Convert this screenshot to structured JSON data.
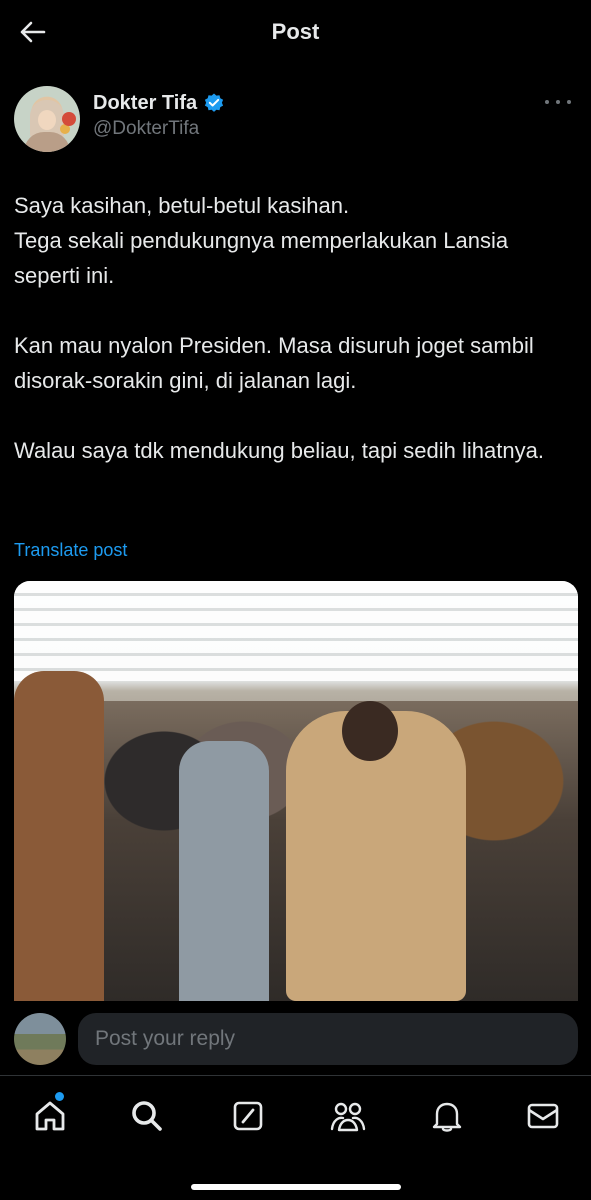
{
  "header": {
    "title": "Post"
  },
  "author": {
    "display_name": "Dokter Tifa",
    "handle": "@DokterTifa",
    "verified": true,
    "verified_color": "#1d9bf0"
  },
  "post": {
    "paragraphs": [
      "Saya kasihan, betul-betul kasihan.\nTega sekali pendukungnya memperlakukan Lansia seperti ini.",
      "Kan mau nyalon Presiden. Masa disuruh joget sambil disorak-sorakin gini, di jalanan lagi.",
      "Walau saya tdk mendukung beliau, tapi sedih lihatnya."
    ],
    "translate_label": "Translate post"
  },
  "reply": {
    "placeholder": "Post your reply"
  },
  "nav": {
    "items": [
      {
        "icon": "home-icon",
        "has_notification_dot": true
      },
      {
        "icon": "search-icon"
      },
      {
        "icon": "grok-icon"
      },
      {
        "icon": "communities-icon"
      },
      {
        "icon": "notifications-icon"
      },
      {
        "icon": "messages-icon"
      }
    ]
  },
  "colors": {
    "background": "#000000",
    "text": "#e7e9ea",
    "muted": "#71767b",
    "accent": "#1d9bf0"
  }
}
